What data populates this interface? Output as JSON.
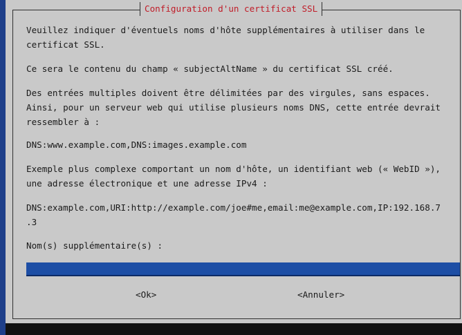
{
  "dialog": {
    "title": "Configuration d'un certificat SSL",
    "paragraphs": [
      "Veuillez indiquer d'éventuels noms d'hôte supplémentaires à utiliser dans le\ncertificat SSL.",
      "Ce sera le contenu du champ « subjectAltName » du certificat SSL créé.",
      "Des entrées multiples doivent être délimitées par des virgules, sans espaces.\nAinsi, pour un serveur web qui utilise plusieurs noms DNS, cette entrée devrait\nressembler à :",
      "DNS:www.example.com,DNS:images.example.com",
      "Exemple plus complexe comportant un nom d'hôte, un identifiant web (« WebID »),\nune adresse électronique et une adresse IPv4 :",
      "DNS:example.com,URI:http://example.com/joe#me,email:me@example.com,IP:192.168.7\n.3",
      "Nom(s) supplémentaire(s) :"
    ],
    "input_value": "",
    "buttons": {
      "ok": "<Ok>",
      "cancel": "<Annuler>"
    }
  },
  "colors": {
    "background": "#1e3f8a",
    "dialog": "#c9c9c9",
    "title": "#c01c28",
    "input": "#1d4ea5"
  }
}
